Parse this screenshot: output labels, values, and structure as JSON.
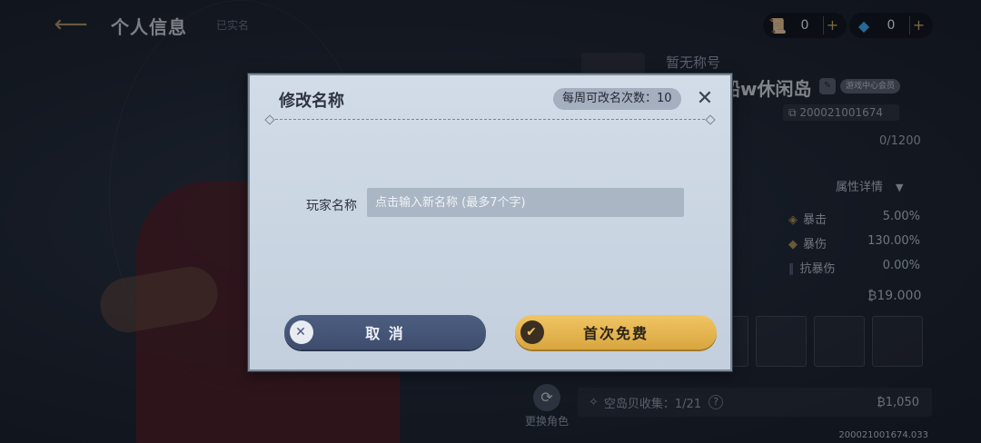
{
  "header": {
    "title": "个人信息",
    "verify_tag": "已实名",
    "currencies": [
      {
        "icon": "scroll-icon",
        "value": "0",
        "plus": "+"
      },
      {
        "icon": "diamond-icon",
        "value": "0",
        "plus": "+"
      }
    ]
  },
  "profile": {
    "no_title": "暂无称号",
    "name": "船w休闲岛",
    "badge": "游戏中心会员",
    "uid": "200021001674",
    "exp": "0/1200",
    "attr_detail": "属性详情",
    "stats": [
      {
        "label": "暴击",
        "value": "5.00%"
      },
      {
        "label": "暴伤",
        "value": "130.00%"
      },
      {
        "label": "抗暴伤",
        "value": "0.00%"
      }
    ],
    "money": "19.000",
    "change_role": "更换角色",
    "collect_label": "空岛贝收集：1/21",
    "collect_help": "?",
    "collect_amount": "1,050",
    "footer_id": "200021001674.033"
  },
  "modal": {
    "title": "修改名称",
    "weekly": "每周可改名次数：10",
    "field_label": "玩家名称",
    "input_value": "",
    "input_placeholder": "点击输入新名称 (最多7个字)",
    "cancel": "取 消",
    "confirm": "首次免费"
  }
}
